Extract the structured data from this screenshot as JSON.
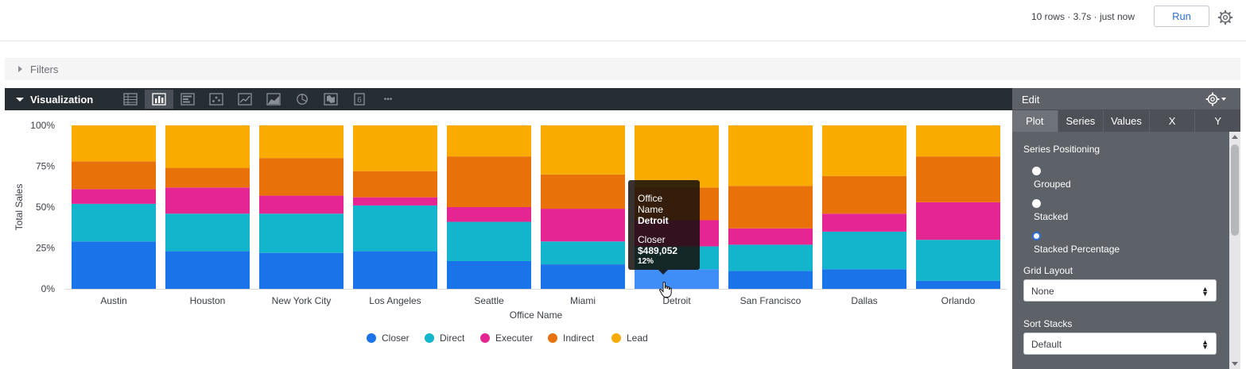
{
  "header": {
    "run_meta": "10 rows · 3.7s · just now",
    "run_label": "Run"
  },
  "filters": {
    "label": "Filters"
  },
  "visualization": {
    "title": "Visualization",
    "types": [
      "table-icon",
      "column-chart-icon",
      "bar-chart-icon",
      "scatter-icon",
      "line-chart-icon",
      "area-chart-icon",
      "pie-chart-icon",
      "map-icon",
      "single-value-icon",
      "more-icon"
    ],
    "active_type": "column-chart-icon",
    "single_value_glyph": "6",
    "more_glyph": "•••"
  },
  "tooltip": {
    "dim_label": "Office Name",
    "dim_value": "Detroit",
    "series": "Closer",
    "value": "$489,052",
    "percent": "12%"
  },
  "edit": {
    "title": "Edit",
    "tabs": [
      "Plot",
      "Series",
      "Values",
      "X",
      "Y"
    ],
    "active_tab": "Plot",
    "series_positioning_label": "Series Positioning",
    "options": [
      "Grouped",
      "Stacked",
      "Stacked Percentage"
    ],
    "selected_option": "Stacked Percentage",
    "grid_layout_label": "Grid Layout",
    "grid_layout_value": "None",
    "sort_stacks_label": "Sort Stacks",
    "sort_stacks_value": "Default"
  },
  "chart_data": {
    "type": "bar",
    "stacked": "percent",
    "categories": [
      "Austin",
      "Houston",
      "New York City",
      "Los Angeles",
      "Seattle",
      "Miami",
      "Detroit",
      "San Francisco",
      "Dallas",
      "Orlando"
    ],
    "series": [
      {
        "name": "Closer",
        "color": "#1a73e8",
        "values": [
          29,
          23,
          22,
          23,
          17,
          15,
          12,
          11,
          12,
          5
        ]
      },
      {
        "name": "Direct",
        "color": "#12b5cb",
        "values": [
          23,
          23,
          24,
          28,
          24,
          14,
          14,
          16,
          23,
          25
        ]
      },
      {
        "name": "Executer",
        "color": "#e52592",
        "values": [
          9,
          16,
          11,
          5,
          9,
          20,
          16,
          10,
          11,
          23
        ]
      },
      {
        "name": "Indirect",
        "color": "#e8710a",
        "values": [
          17,
          12,
          23,
          16,
          31,
          21,
          20,
          26,
          23,
          28
        ]
      },
      {
        "name": "Lead",
        "color": "#f9ab00",
        "values": [
          22,
          26,
          20,
          28,
          19,
          30,
          38,
          37,
          31,
          19
        ]
      }
    ],
    "highlight": {
      "category": "Detroit",
      "series": "Closer",
      "color": "#3f8ef7"
    },
    "yticks": [
      "0%",
      "25%",
      "50%",
      "75%",
      "100%"
    ],
    "ylim": [
      0,
      100
    ],
    "xlabel": "Office Name",
    "ylabel": "Total Sales",
    "legend_position": "bottom"
  }
}
